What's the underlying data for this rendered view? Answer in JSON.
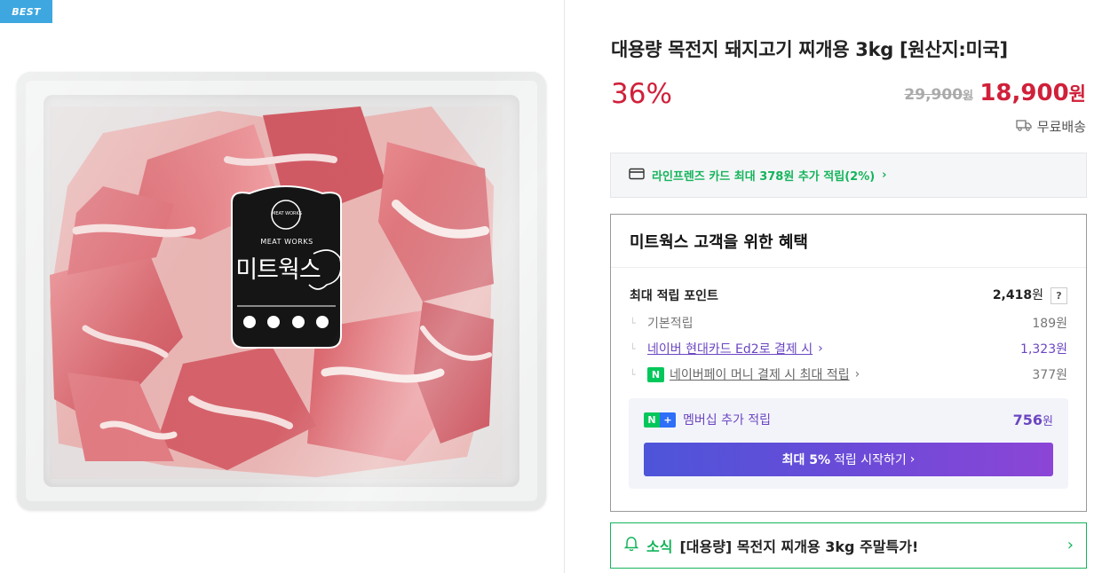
{
  "badge": "BEST",
  "product": {
    "title": "대용량 목전지 돼지고기 찌개용 3kg [원산지:미국]",
    "discount": "36%",
    "original_price": "29,900",
    "original_unit": "원",
    "price": "18,900",
    "price_unit": "원",
    "shipping": "무료배송"
  },
  "package_label": {
    "brand_en": "MEAT WORKS",
    "brand_ko": "미트웍스",
    "seal_text": "MEAT WORKS"
  },
  "card_promo": "라인프렌즈 카드 최대 378원 추가 적립(2%)",
  "benefits": {
    "title": "미트웍스 고객을 위한 혜택",
    "max_points_label": "최대 적립 포인트",
    "max_points_value": "2,418",
    "max_points_unit": "원",
    "help": "?",
    "rows": [
      {
        "label": "기본적립",
        "value": "189원"
      },
      {
        "label": "네이버 현대카드 Ed2로 결제 시",
        "value": "1,323원"
      },
      {
        "label": "네이버페이 머니 결제 시 최대 적립",
        "value": "377원"
      }
    ],
    "npay_icon_text": "N",
    "membership": {
      "label": "멤버십 추가 적립",
      "value": "756",
      "unit": "원",
      "n": "N",
      "plus": "+"
    },
    "cta_strong": "최대 5%",
    "cta_rest": "적립 시작하기"
  },
  "news": {
    "tag": "소식",
    "text": "[대용량] 목전지 찌개용 3kg 주말특가!"
  },
  "colors": {
    "accent_red": "#d0203a",
    "naver_green": "#14b45b",
    "purple": "#6b46c1"
  }
}
